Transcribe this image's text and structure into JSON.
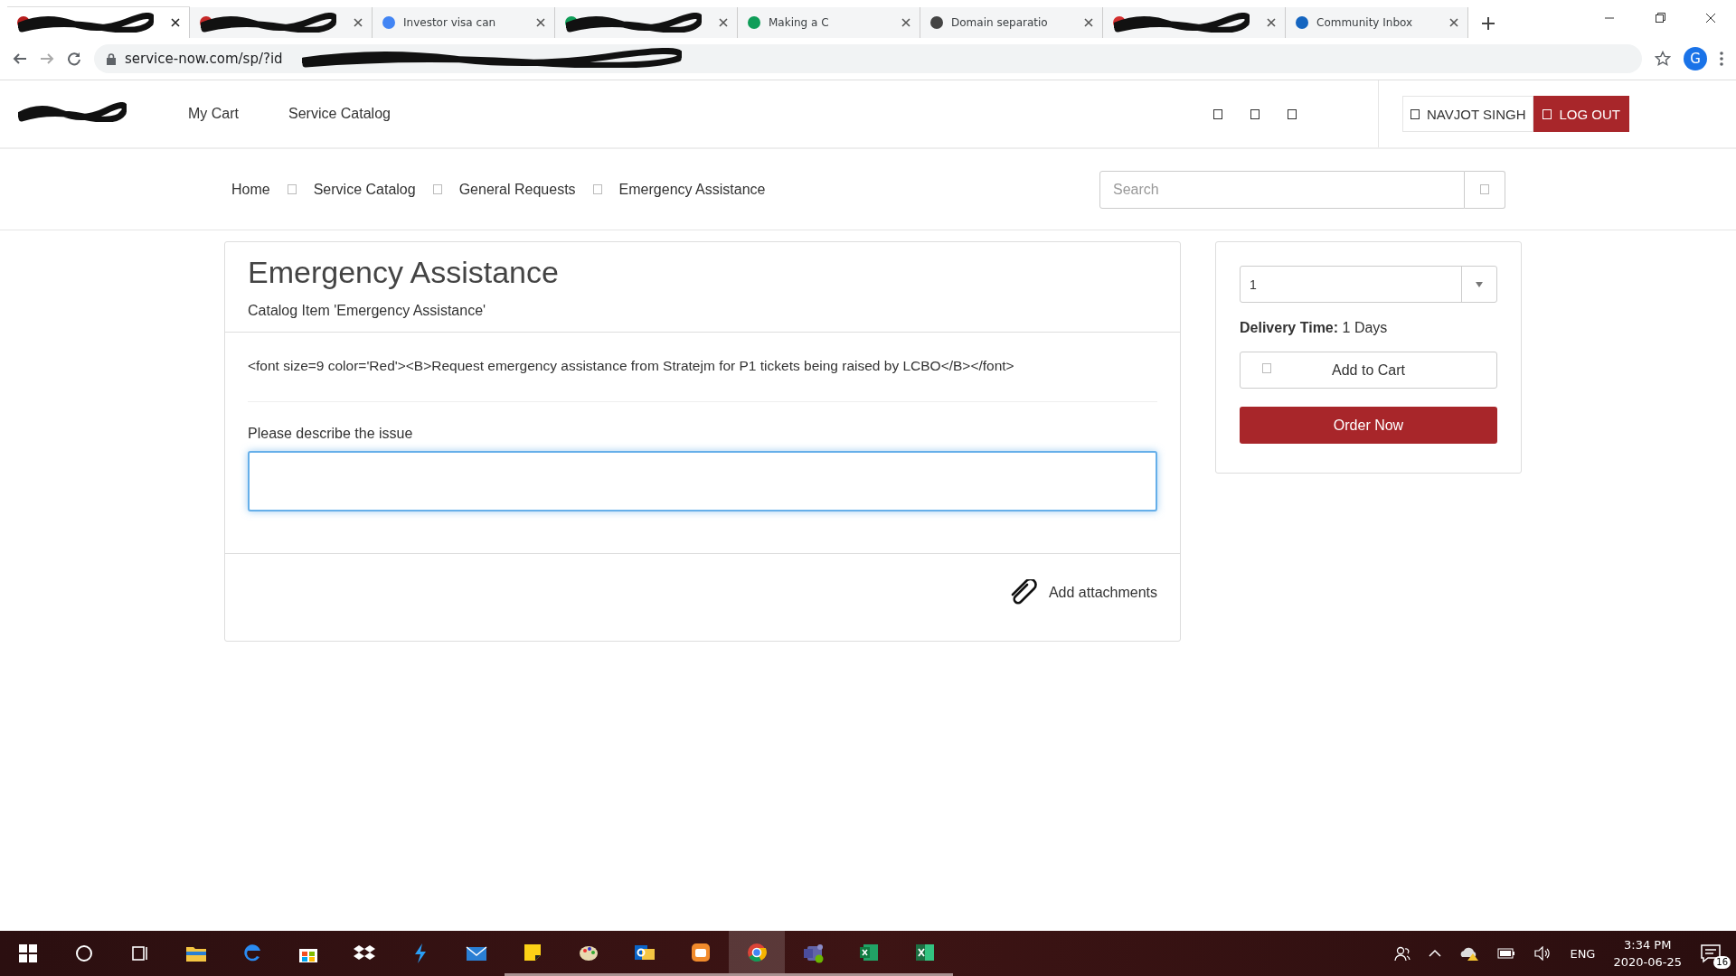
{
  "browser": {
    "tabs": [
      {
        "redacted": true,
        "selected": true
      },
      {
        "redacted": true,
        "selected": false
      },
      {
        "title": "Investor visa can",
        "redacted": false,
        "selected": false
      },
      {
        "redacted": true,
        "selected": false
      },
      {
        "title": "Making a C",
        "redacted": false,
        "selected": false
      },
      {
        "title": "Domain separatio",
        "redacted": false,
        "selected": false
      },
      {
        "redacted": true,
        "selected": false
      },
      {
        "title": "Community Inbox",
        "redacted": false,
        "selected": false
      }
    ],
    "url": "service-now.com/sp/?id",
    "url_redacted": true,
    "profile_initial": "G"
  },
  "header": {
    "logo_redacted": true,
    "nav": [
      "My Cart",
      "Service Catalog"
    ],
    "user": "NAVJOT SINGH",
    "logout": "LOG OUT"
  },
  "breadcrumbs": [
    "Home",
    "Service Catalog",
    "General Requests",
    "Emergency Assistance"
  ],
  "search": {
    "placeholder": "Search"
  },
  "item": {
    "title": "Emergency Assistance",
    "subtitle": "Catalog Item 'Emergency Assistance'",
    "description": "<font size=9 color='Red'><B>Request emergency assistance from Stratejm for P1 tickets being raised by LCBO</B></font>",
    "field_label": "Please describe the issue",
    "field_focused": true,
    "attachments": "Add attachments"
  },
  "order": {
    "quantity": "1",
    "delivery": "**Delivery Time:** 1 Days",
    "add_to_cart": "Add to Cart",
    "order_now": "Order Now"
  },
  "taskbar": {
    "apps": [
      {
        "selected": false,
        "running": false
      },
      {
        "selected": false,
        "running": false
      },
      {
        "selected": false,
        "running": false
      },
      {
        "selected": false,
        "running": false
      },
      {
        "selected": false,
        "running": false
      },
      {
        "selected": false,
        "running": false
      },
      {
        "selected": false,
        "running": true
      },
      {
        "selected": false,
        "running": true
      },
      {
        "selected": false,
        "running": true
      },
      {
        "selected": false,
        "running": true
      },
      {
        "selected": true,
        "running": true
      },
      {
        "selected": false,
        "running": true
      },
      {
        "selected": false,
        "running": true
      },
      {
        "selected": false,
        "running": true
      }
    ],
    "language": "ENG",
    "time": "3:34 PM",
    "date": "2020-06-25",
    "notifications": "16"
  }
}
